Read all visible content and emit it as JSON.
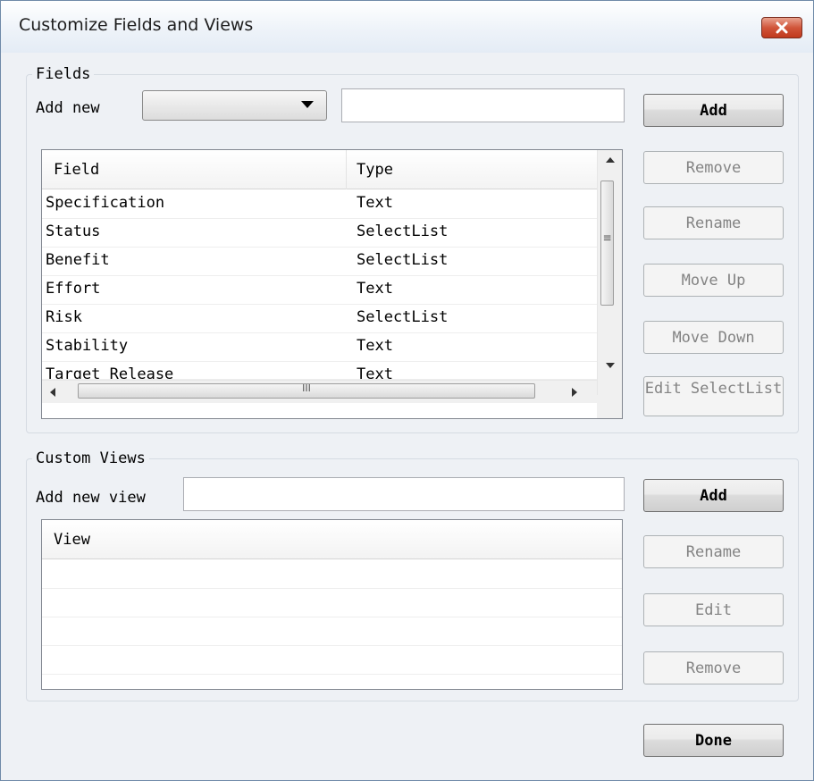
{
  "window": {
    "title": "Customize Fields and Views"
  },
  "fields": {
    "legend": "Fields",
    "add_new_label": "Add new",
    "combo_value": "",
    "new_field_value": "",
    "add_button": "Add",
    "columns": [
      "Field",
      "Type"
    ],
    "rows": [
      {
        "field": "Specification",
        "type": "Text"
      },
      {
        "field": "Status",
        "type": "SelectList"
      },
      {
        "field": "Benefit",
        "type": "SelectList"
      },
      {
        "field": "Effort",
        "type": "Text"
      },
      {
        "field": "Risk",
        "type": "SelectList"
      },
      {
        "field": "Stability",
        "type": "Text"
      },
      {
        "field": "Target Release",
        "type": "Text"
      }
    ],
    "buttons": {
      "remove": "Remove",
      "rename": "Rename",
      "move_up": "Move Up",
      "move_down": "Move Down",
      "edit_selectlist": "Edit SelectList"
    },
    "hscroll_thumb_glyph": "III",
    "vscroll_thumb_glyph": "≡"
  },
  "views": {
    "legend": "Custom Views",
    "add_new_label": "Add new view",
    "new_view_value": "",
    "add_button": "Add",
    "column": "View",
    "buttons": {
      "rename": "Rename",
      "edit": "Edit",
      "remove": "Remove"
    }
  },
  "footer": {
    "done_button": "Done"
  },
  "colors": {
    "window_bg": "#eef1f5",
    "close_button": "#c9452a",
    "disabled_text": "#838383"
  },
  "icons": {
    "close": "close-icon",
    "dropdown": "chevron-down-icon",
    "scroll_up": "triangle-up-icon",
    "scroll_down": "triangle-down-icon",
    "scroll_left": "triangle-left-icon",
    "scroll_right": "triangle-right-icon"
  }
}
